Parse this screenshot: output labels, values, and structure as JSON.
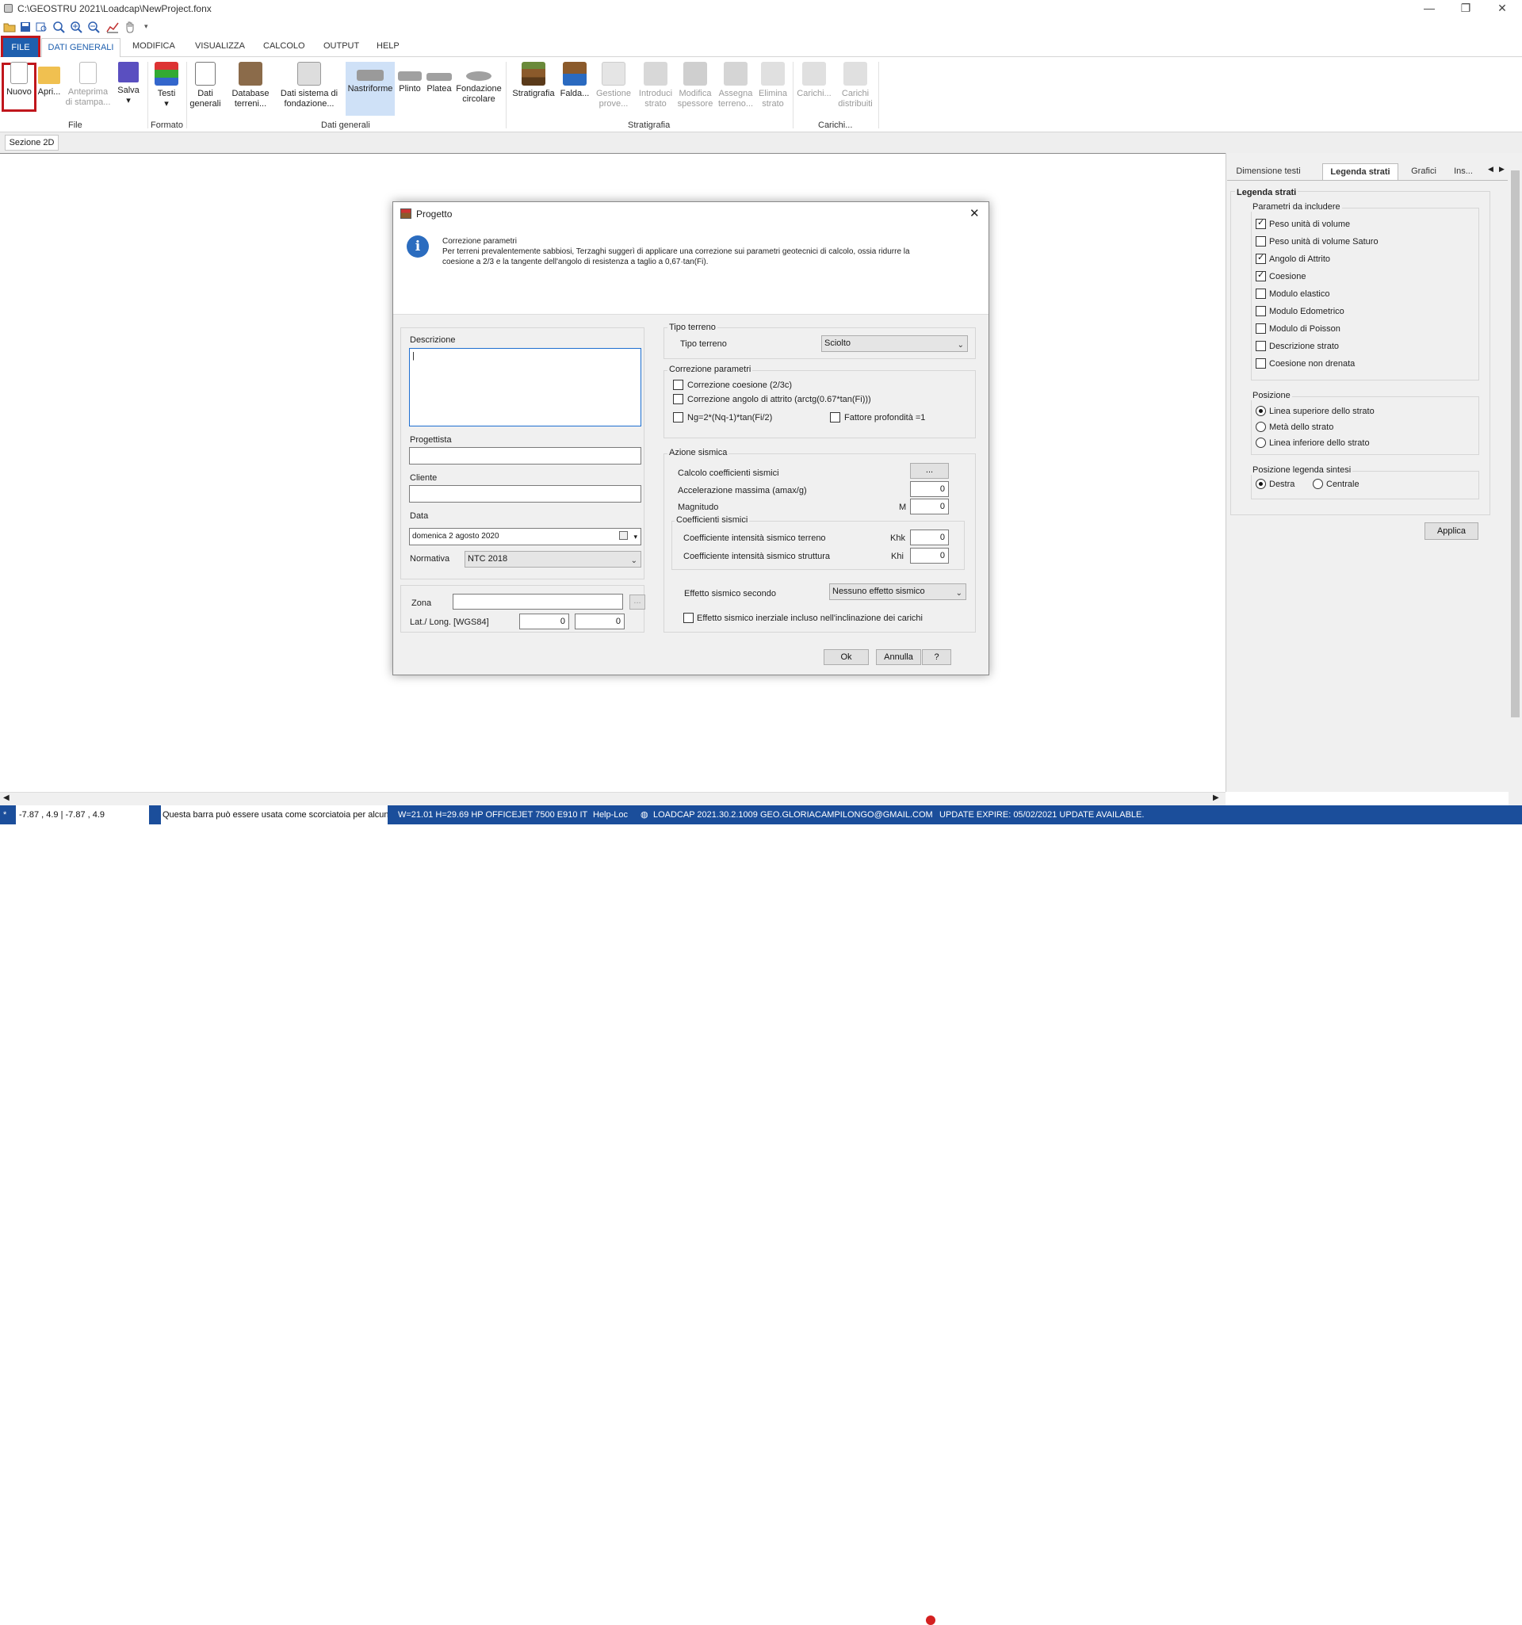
{
  "window": {
    "title": "C:\\GEOSTRU 2021\\Loadcap\\NewProject.fonx",
    "minimize": "—",
    "restore": "❐",
    "close": "✕"
  },
  "menu": {
    "tabs": [
      "FILE",
      "DATI GENERALI",
      "MODIFICA",
      "VISUALIZZA",
      "CALCOLO",
      "OUTPUT",
      "HELP"
    ]
  },
  "ribbon": {
    "buttons": {
      "nuovo": "Nuovo",
      "apri": "Apri...",
      "anteprima_1": "Anteprima",
      "anteprima_2": "di stampa...",
      "salva": "Salva",
      "testi": "Testi",
      "dati_generali_1": "Dati",
      "dati_generali_2": "generali",
      "database_1": "Database",
      "database_2": "terreni...",
      "dati_sistema_1": "Dati sistema di",
      "dati_sistema_2": "fondazione...",
      "nastriforme": "Nastriforme",
      "plinto": "Plinto",
      "platea": "Platea",
      "fondazione_1": "Fondazione",
      "fondazione_2": "circolare",
      "stratigrafia": "Stratigrafia",
      "falda": "Falda...",
      "gestione_1": "Gestione",
      "gestione_2": "prove...",
      "introduci_1": "Introduci",
      "introduci_2": "strato",
      "modifica_1": "Modifica",
      "modifica_2": "spessore",
      "assegna_1": "Assegna",
      "assegna_2": "terreno...",
      "elimina_1": "Elimina",
      "elimina_2": "strato",
      "carichi": "Carichi...",
      "carichi_dist_1": "Carichi",
      "carichi_dist_2": "distribuiti"
    },
    "groups": {
      "file": "File",
      "formato": "Formato",
      "dati_generali": "Dati generali",
      "stratigrafia": "Stratigrafia",
      "carichi": "Carichi..."
    },
    "colors": {
      "file_tab": "#1e5fae",
      "highlight": "#c0161c"
    }
  },
  "doc_tab": "Sezione 2D",
  "right_panel": {
    "tabs": [
      "Dimensione testi",
      "Legenda strati",
      "Grafici",
      "Ins..."
    ],
    "active_tab": "Legenda strati",
    "title": "Legenda strati",
    "params_group": "Parametri da includere",
    "params": [
      {
        "label": "Peso unità di volume",
        "checked": true
      },
      {
        "label": "Peso unità di volume Saturo",
        "checked": false
      },
      {
        "label": "Angolo di Attrito",
        "checked": true
      },
      {
        "label": "Coesione",
        "checked": true
      },
      {
        "label": "Modulo elastico",
        "checked": false
      },
      {
        "label": "Modulo Edometrico",
        "checked": false
      },
      {
        "label": "Modulo di Poisson",
        "checked": false
      },
      {
        "label": "Descrizione strato",
        "checked": false
      },
      {
        "label": "Coesione non drenata",
        "checked": false
      }
    ],
    "position_group": "Posizione",
    "positions": [
      {
        "label": "Linea superiore dello strato",
        "selected": true
      },
      {
        "label": "Metà dello strato",
        "selected": false
      },
      {
        "label": "Linea inferiore dello strato",
        "selected": false
      }
    ],
    "legend_pos_group": "Posizione legenda sintesi",
    "legend_pos": [
      {
        "label": "Destra",
        "selected": true
      },
      {
        "label": "Centrale",
        "selected": false
      }
    ],
    "apply": "Applica"
  },
  "dialog": {
    "title": "Progetto",
    "info_title": "Correzione parametri",
    "info_line1": "Per terreni prevalentemente sabbiosi, Terzaghi suggerì di  applicare una correzione sui parametri geotecnici di calcolo, ossia ridurre la",
    "info_line2": "coesione a 2/3 e la tangente dell'angolo di resistenza a taglio a 0,67·tan(Fi).",
    "descrizione_label": "Descrizione",
    "descrizione_value": "|",
    "progettista_label": "Progettista",
    "progettista_value": "",
    "cliente_label": "Cliente",
    "cliente_value": "",
    "data_label": "Data",
    "data_value": "domenica   2    agosto    2020",
    "normativa_label": "Normativa",
    "normativa_value": "NTC 2018",
    "zona_label": "Zona",
    "zona_value": "",
    "zona_btn": "...",
    "latlong_label": "Lat./ Long. [WGS84]",
    "lat_value": "0",
    "long_value": "0",
    "tipo_terreno_group": "Tipo terreno",
    "tipo_terreno_label": "Tipo terreno",
    "tipo_terreno_value": "Sciolto",
    "correzione_group": "Correzione parametri",
    "corr_coesione": "Correzione coesione (2/3c)",
    "corr_attrito": "Correzione angolo di attrito (arctg(0.67*tan(Fi)))",
    "ng": "Ng=2*(Nq-1)*tan(Fi/2)",
    "fattore": "Fattore profondità =1",
    "azione_group": "Azione sismica",
    "calcolo_coeff": "Calcolo coefficienti sismici",
    "calcolo_btn": "...",
    "accelerazione": "Accelerazione massima (amax/g)",
    "accelerazione_value": "0",
    "magnitudo": "Magnitudo",
    "magnitudo_unit": "M",
    "magnitudo_value": "0",
    "coeff_group": "Coefficienti sismici",
    "coeff_terreno": "Coefficiente intensità sismico terreno",
    "khk": "Khk",
    "khk_value": "0",
    "coeff_struttura": "Coefficiente intensità sismico struttura",
    "khi": "Khi",
    "khi_value": "0",
    "effetto_label": "Effetto sismico secondo",
    "effetto_value": "Nessuno effetto sismico",
    "inerziale": "Effetto sismico inerziale incluso nell'inclinazione dei carichi",
    "ok": "Ok",
    "annulla": "Annulla",
    "help": "?"
  },
  "status": {
    "coords": "-7.87 , 4.9 | -7.87 , 4.9",
    "hint": "Questa barra può essere usata come scorciatoia per alcuni",
    "printer": "W=21.01 H=29.69 HP OFFICEJET 7500 E910  IT",
    "help": "Help-Loc",
    "version": "LOADCAP 2021.30.2.1009 GEO.GLORIACAMPILONGO@GMAIL.COM",
    "expire": "UPDATE EXPIRE: 05/02/2021 UPDATE AVAILABLE."
  }
}
